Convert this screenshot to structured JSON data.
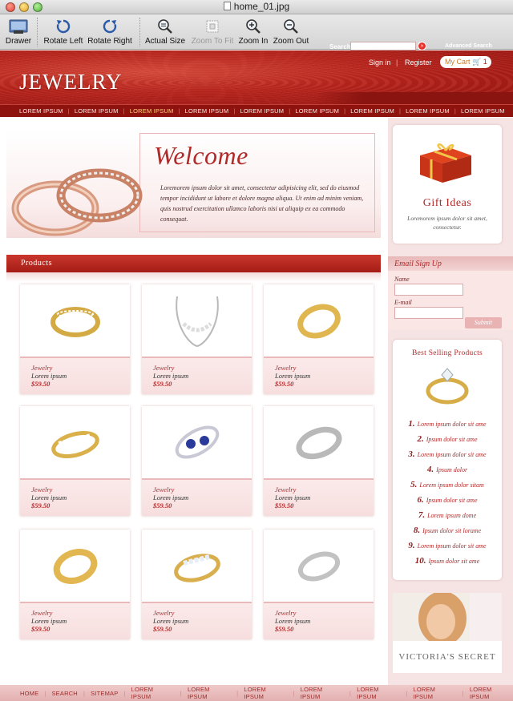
{
  "window": {
    "title": "home_01.jpg"
  },
  "toolbar": {
    "drawer": "Drawer",
    "rotate_left": "Rotate Left",
    "rotate_right": "Rotate Right",
    "actual_size": "Actual Size",
    "zoom_to_fit": "Zoom To Fit",
    "zoom_in": "Zoom In",
    "zoom_out": "Zoom Out"
  },
  "header": {
    "logo": "JEWELRY",
    "sign_in": "Sign in",
    "register": "Register",
    "cart_label": "My Cart",
    "cart_count": "1",
    "search_label": "Search",
    "search_go": "»",
    "advanced_search": "Advanced Search"
  },
  "nav": [
    "LOREM IPSUM",
    "LOREM IPSUM",
    "LOREM IPSUM",
    "LOREM IPSUM",
    "LOREM IPSUM",
    "LOREM IPSUM",
    "LOREM IPSUM",
    "LOREM IPSUM",
    "LOREM IPSUM"
  ],
  "nav_active_index": 2,
  "welcome": {
    "title": "Welcome",
    "text": "Loremorem ipsum dolor sit amet, consectetur adipisicing elit, sed do eiusmod tempor incididunt ut labore et dolore magna aliqua. Ut enim ad minim veniam, quis nostrud exercitation ullamco laboris nisi ut aliquip ex ea commodo consequat."
  },
  "products": {
    "heading": "Products",
    "items": [
      {
        "category": "Jewelry",
        "name": "Lorem ipsum",
        "price": "$59.50",
        "icon": "diamond-band-ring-icon"
      },
      {
        "category": "Jewelry",
        "name": "Lorem ipsum",
        "price": "$59.50",
        "icon": "diamond-necklace-icon"
      },
      {
        "category": "Jewelry",
        "name": "Lorem ipsum",
        "price": "$59.50",
        "icon": "gold-band-ring-icon"
      },
      {
        "category": "Jewelry",
        "name": "Lorem ipsum",
        "price": "$59.50",
        "icon": "baguette-gold-ring-icon"
      },
      {
        "category": "Jewelry",
        "name": "Lorem ipsum",
        "price": "$59.50",
        "icon": "sapphire-bypass-ring-icon"
      },
      {
        "category": "Jewelry",
        "name": "Lorem ipsum",
        "price": "$59.50",
        "icon": "silver-band-ring-icon"
      },
      {
        "category": "Jewelry",
        "name": "Lorem ipsum",
        "price": "$59.50",
        "icon": "gold-band-ring-icon"
      },
      {
        "category": "Jewelry",
        "name": "Lorem ipsum",
        "price": "$59.50",
        "icon": "diamond-gold-ring-icon"
      },
      {
        "category": "Jewelry",
        "name": "Lorem ipsum",
        "price": "$59.50",
        "icon": "silver-band-ring-icon"
      }
    ]
  },
  "gift": {
    "title": "Gift Ideas",
    "text": "Loremorem ipsum dolor sit amet, consectetur."
  },
  "email_signup": {
    "title": "Email Sign Up",
    "name_label": "Name",
    "email_label": "E-mail",
    "submit": "Submit"
  },
  "best_selling": {
    "title": "Best Selling Products",
    "items": [
      {
        "n": "1.",
        "text": "Lorem ipsum dolor sit ame"
      },
      {
        "n": "2.",
        "text": "Ipsum dolor sit ame"
      },
      {
        "n": "3.",
        "text": "Lorem ipsum dolor sit ame"
      },
      {
        "n": "4.",
        "text": "Ipsum dolor"
      },
      {
        "n": "5.",
        "text": "Lorem ipsum dolor sitam"
      },
      {
        "n": "6.",
        "text": "Ipsum dolor sit ame"
      },
      {
        "n": "7.",
        "text": "Lorem ipsum dome"
      },
      {
        "n": "8.",
        "text": "Ipsum dolor sit lorame"
      },
      {
        "n": "9.",
        "text": "Lorem ipsum dolor sit ame"
      },
      {
        "n": "10.",
        "text": "Ipsum dolor sit ame"
      }
    ]
  },
  "ad": {
    "brand": "VICTORIA'S SECRET"
  },
  "footer": [
    "HOME",
    "SEARCH",
    "SITEMAP",
    "LOREM IPSUM",
    "LOREM IPSUM",
    "LOREM IPSUM",
    "LOREM IPSUM",
    "LOREM IPSUM",
    "LOREM IPSUM",
    "LOREM IPSUM"
  ],
  "colors": {
    "brand_red": "#b8241c",
    "accent_gold": "#ffd27a",
    "panel_pink": "#f6e4e4"
  }
}
